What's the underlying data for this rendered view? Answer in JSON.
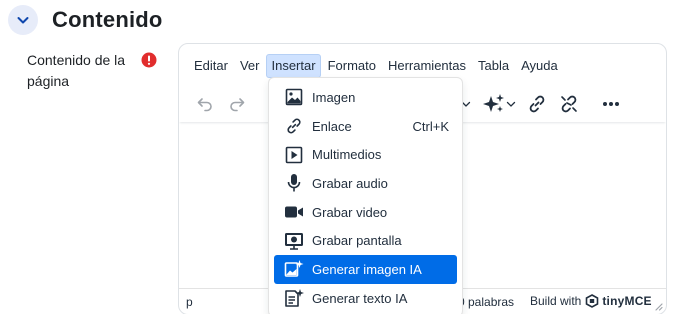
{
  "section": {
    "title": "Contenido"
  },
  "field": {
    "label": "Contenido de la página"
  },
  "menubar": {
    "items": [
      "Editar",
      "Ver",
      "Insertar",
      "Formato",
      "Herramientas",
      "Tabla",
      "Ayuda"
    ],
    "active": "Insertar"
  },
  "toolbar": {
    "icons": [
      "undo-icon",
      "redo-icon",
      "ai-sparkles-icon",
      "link-icon",
      "unlink-icon",
      "more-icon"
    ]
  },
  "dropdown": {
    "items": [
      {
        "label": "Imagen",
        "icon": "image-icon",
        "shortcut": ""
      },
      {
        "label": "Enlace",
        "icon": "link-icon",
        "shortcut": "Ctrl+K"
      },
      {
        "label": "Multimedios",
        "icon": "media-icon",
        "shortcut": ""
      },
      {
        "label": "Grabar audio",
        "icon": "microphone-icon",
        "shortcut": ""
      },
      {
        "label": "Grabar video",
        "icon": "video-camera-icon",
        "shortcut": ""
      },
      {
        "label": "Grabar pantalla",
        "icon": "screen-record-icon",
        "shortcut": ""
      },
      {
        "label": "Generar imagen IA",
        "icon": "ai-image-icon",
        "shortcut": ""
      },
      {
        "label": "Generar texto IA",
        "icon": "ai-text-icon",
        "shortcut": ""
      }
    ],
    "highlighted_index": 6
  },
  "statusbar": {
    "path": "p",
    "word_count": "0 palabras",
    "brand_prefix": "Build with",
    "brand_name": "tinyMCE"
  },
  "colors": {
    "accent": "#006ce7",
    "required": "#e12d2d",
    "menu_active_bg": "#cfe2ff"
  }
}
